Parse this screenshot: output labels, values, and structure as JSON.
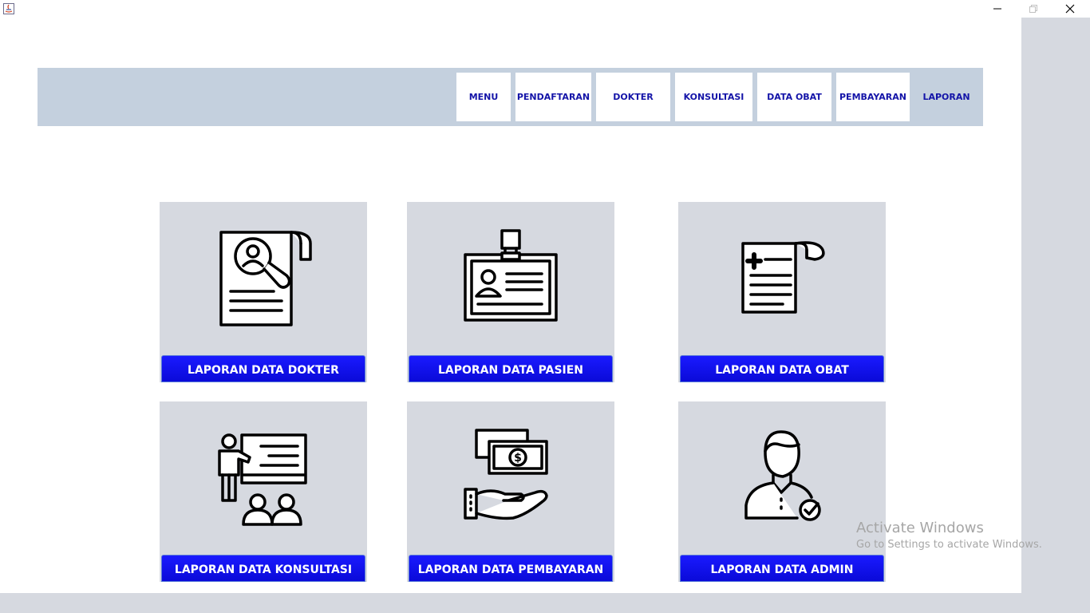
{
  "window": {
    "controls": {
      "minimize_icon": "minimize-icon",
      "maximize_icon": "restore-icon",
      "close_icon": "close-icon"
    }
  },
  "nav": {
    "items": [
      {
        "label": "MENU",
        "active": false
      },
      {
        "label": "PENDAFTARAN",
        "active": false
      },
      {
        "label": "DOKTER",
        "active": false
      },
      {
        "label": "KONSULTASI",
        "active": false
      },
      {
        "label": "DATA OBAT",
        "active": false
      },
      {
        "label": "PEMBAYARAN",
        "active": false
      },
      {
        "label": "LAPORAN",
        "active": true
      }
    ]
  },
  "cards": [
    {
      "label": "LAPORAN DATA DOKTER",
      "icon": "doctor-report-icon"
    },
    {
      "label": "LAPORAN DATA PASIEN",
      "icon": "id-card-icon"
    },
    {
      "label": "LAPORAN DATA OBAT",
      "icon": "prescription-icon"
    },
    {
      "label": "LAPORAN DATA KONSULTASI",
      "icon": "presentation-icon"
    },
    {
      "label": "LAPORAN DATA PEMBAYARAN",
      "icon": "payment-icon"
    },
    {
      "label": "LAPORAN DATA ADMIN",
      "icon": "admin-user-icon"
    }
  ],
  "watermark": {
    "title": "Activate Windows",
    "subtitle": "Go to Settings to activate Windows."
  },
  "colors": {
    "nav_bg": "#c4d0de",
    "nav_text": "#1414a8",
    "card_bg": "#d6d9e0",
    "button_blue": "#1010f0"
  }
}
